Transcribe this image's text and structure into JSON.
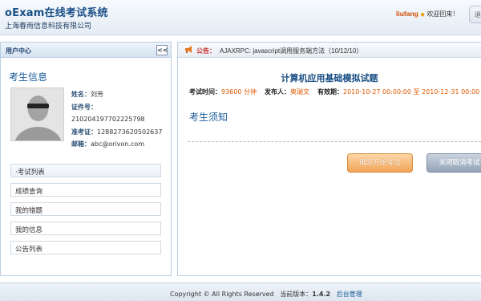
{
  "header": {
    "system_title": "oExam在线考试系统",
    "company": "上海春雨信息科技有限公司",
    "username": "liufang",
    "welcome": "欢迎回来！",
    "logout_label": "退"
  },
  "sidebar": {
    "title": "用户中心",
    "collapse_label": "<<",
    "section_title": "考生信息",
    "profile": {
      "name_label": "姓名：",
      "name": "刘芳",
      "id_label": "证件号：",
      "id_number": "210204197702225798",
      "ticket_label": "准考证：",
      "ticket": "1288273620502637",
      "email_label": "邮箱：",
      "email": "abc@orivon.com"
    },
    "menu": [
      {
        "label": "·考试列表",
        "active": true
      },
      {
        "label": "成绩查询",
        "active": false
      },
      {
        "label": "我的错题",
        "active": false
      },
      {
        "label": "我的信息",
        "active": false
      },
      {
        "label": "公告列表",
        "active": false
      }
    ]
  },
  "main": {
    "notice_label": "公告：",
    "notice_text": "AJAXRPC: javascript调用服务端方法（10/12/10）",
    "exam_title": "计算机应用基础模拟试题",
    "meta": {
      "time_label": "考试时间：",
      "time_value": "93600 分钟",
      "publisher_label": "发布人：",
      "publisher_value": "奥瑞文",
      "valid_label": "有效期：",
      "valid_value": "2010-10-27 00:00:00 至 2010-12-31 00:00"
    },
    "notice_heading": "考生须知",
    "start_button": "确定开始考试",
    "close_button": "关闭取消考试"
  },
  "footer": {
    "copyright": "Copyright © All Rights Reserved",
    "version_label": "当前版本：",
    "version": "1.4.2",
    "admin_link": "后台管理"
  },
  "colors": {
    "brand_blue": "#1a4f86",
    "accent_orange": "#e05a00",
    "start_button": "#f0a456",
    "close_button": "#93a3b6"
  }
}
